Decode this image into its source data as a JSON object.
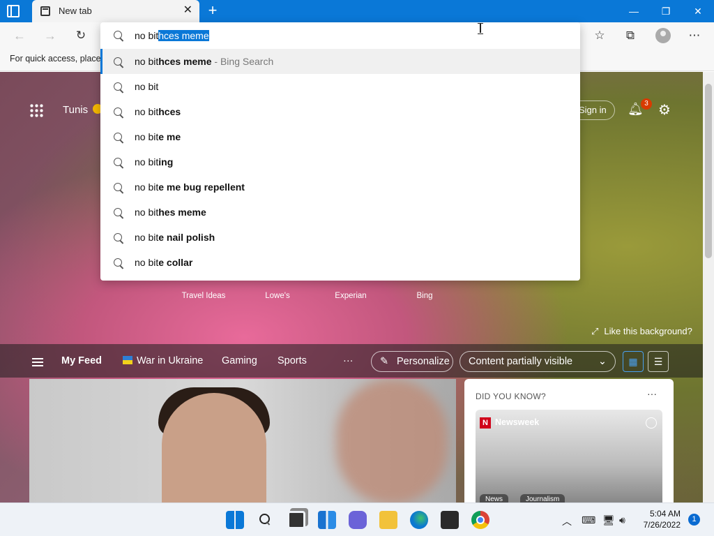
{
  "browser": {
    "tab_title": "New tab",
    "tab_close": "✕",
    "new_tab": "+",
    "win_minimize": "—",
    "win_restore": "❐",
    "win_close": "✕",
    "favorites_hint": "For quick access, place y",
    "toolbar_icons": {
      "favorites": "☆",
      "collections": "⧉",
      "more": "⋯",
      "back": "←",
      "forward": "→",
      "refresh": "↻"
    }
  },
  "address_bar": {
    "typed": "no bit",
    "autocompleted": "hces meme"
  },
  "suggestions": [
    {
      "prefix": "no bit",
      "bold": "hces meme",
      "extra": " - Bing Search",
      "active": true
    },
    {
      "prefix": "no bit",
      "bold": "",
      "extra": "",
      "active": false
    },
    {
      "prefix": "no bit",
      "bold": "hces",
      "extra": "",
      "active": false
    },
    {
      "prefix": "no bit",
      "bold": "e me",
      "extra": "",
      "active": false
    },
    {
      "prefix": "no bit",
      "bold": "ing",
      "extra": "",
      "active": false
    },
    {
      "prefix": "no bit",
      "bold": "e me bug repellent",
      "extra": "",
      "active": false
    },
    {
      "prefix": "no bit",
      "bold": "hes meme",
      "extra": "",
      "active": false
    },
    {
      "prefix": "no bit",
      "bold": "e nail polish",
      "extra": "",
      "active": false
    },
    {
      "prefix": "no bit",
      "bold": "e collar",
      "extra": "",
      "active": false
    }
  ],
  "newtab": {
    "location": "Tunis",
    "sign_in": "Sign in",
    "notifications_count": "3",
    "quick_links": [
      "Travel Ideas",
      "Lowe's",
      "Experian",
      "Bing"
    ],
    "background_credit": "Like this background?",
    "feed": {
      "my_feed": "My Feed",
      "links": [
        "War in Ukraine",
        "Gaming",
        "Sports"
      ],
      "more": "···",
      "personalize": "Personalize",
      "content_visibility": "Content partially visible"
    },
    "did_you_know": {
      "title": "DID YOU KNOW?",
      "source": "Newsweek",
      "source_logo": "N",
      "tags": [
        "News",
        "Journalism"
      ]
    }
  },
  "taskbar": {
    "time": "5:04 AM",
    "date": "7/26/2022",
    "notification_count": "1",
    "apps": [
      "start",
      "search",
      "task-view",
      "widgets",
      "teams-chat",
      "file-explorer",
      "edge",
      "store",
      "chrome"
    ]
  }
}
